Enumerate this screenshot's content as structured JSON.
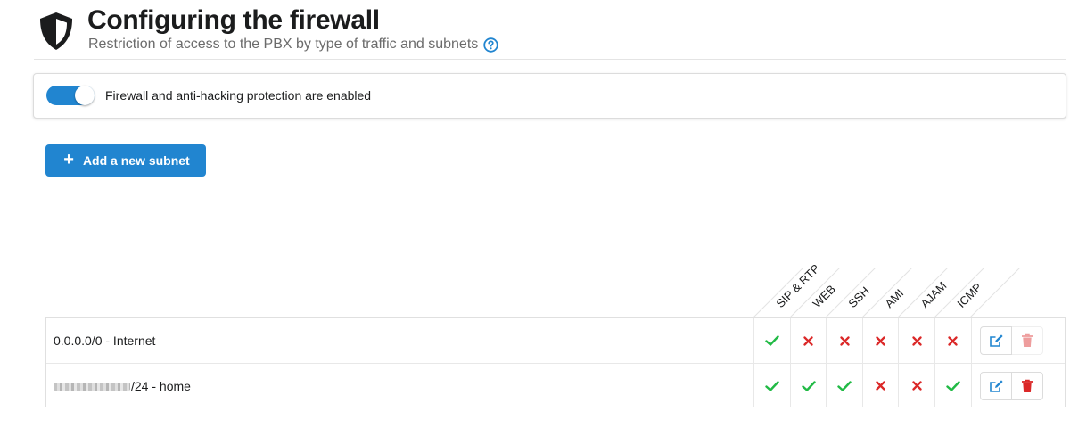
{
  "header": {
    "title": "Configuring the firewall",
    "subtitle": "Restriction of access to the PBX by type of traffic and subnets",
    "icon": "shield-icon",
    "help_icon": "question-circle-icon"
  },
  "firewall_toggle": {
    "enabled": true,
    "label": "Firewall and anti-hacking protection are enabled"
  },
  "add_button": {
    "label": "Add a new subnet",
    "icon": "plus-icon"
  },
  "columns": [
    "SIP & RTP",
    "WEB",
    "SSH",
    "AMI",
    "AJAM",
    "ICMP"
  ],
  "rows": [
    {
      "name": "0.0.0.0/0 - Internet",
      "masked_prefix": false,
      "access": [
        true,
        false,
        false,
        false,
        false,
        false
      ],
      "delete_enabled": false
    },
    {
      "name": "/24 - home",
      "masked_prefix": true,
      "access": [
        true,
        true,
        true,
        false,
        false,
        true
      ],
      "delete_enabled": true
    }
  ],
  "colors": {
    "accent": "#2185d0",
    "allow": "#21ba45",
    "deny": "#db2828",
    "text": "#1b1c1d",
    "muted": "#6b6b6b"
  }
}
